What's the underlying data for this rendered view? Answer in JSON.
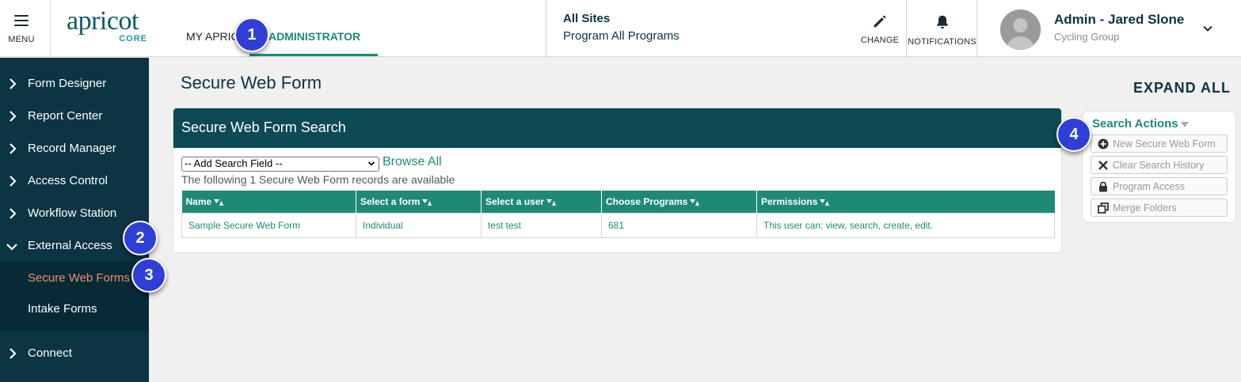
{
  "topbar": {
    "menu_label": "MENU",
    "logo_word": "apricot",
    "logo_sub": "CORE",
    "tabs": [
      {
        "label": "MY APRICOT"
      },
      {
        "label": "ADMINISTRATOR"
      }
    ],
    "site": {
      "name": "All Sites",
      "program": "Program All Programs"
    },
    "change_label": "CHANGE",
    "notifications_label": "NOTIFICATIONS",
    "user": {
      "name": "Admin - Jared Slone",
      "group": "Cycling Group"
    }
  },
  "sidebar": {
    "items": [
      {
        "label": "Form Designer"
      },
      {
        "label": "Report Center"
      },
      {
        "label": "Record Manager"
      },
      {
        "label": "Access Control"
      },
      {
        "label": "Workflow Station"
      },
      {
        "label": "External Access"
      },
      {
        "label": "Connect"
      }
    ],
    "sub_items": [
      {
        "label": "Secure Web Forms",
        "active": true
      },
      {
        "label": "Intake Forms"
      }
    ]
  },
  "main": {
    "page_title": "Secure Web Form",
    "expand_all": "EXPAND ALL",
    "panel_title": "Secure Web Form Search",
    "search_field_selected": "-- Add Search Field --",
    "browse_all": "Browse All",
    "records_note": "The following 1 Secure Web Form records are available",
    "table": {
      "columns": [
        "Name",
        "Select a form",
        "Select a user",
        "Choose Programs",
        "Permissions"
      ],
      "rows": [
        [
          "Sample Secure Web Form",
          "Individual",
          "test test",
          "681",
          "This user can: view, search, create, edit."
        ]
      ]
    }
  },
  "search_actions": {
    "title": "Search Actions",
    "buttons": [
      {
        "label": "New Secure Web Form",
        "icon": "plus-circle-icon"
      },
      {
        "label": "Clear Search History",
        "icon": "x-icon"
      },
      {
        "label": "Program Access",
        "icon": "lock-icon"
      },
      {
        "label": "Merge Folders",
        "icon": "merge-folders-icon"
      }
    ]
  },
  "callouts": [
    "1",
    "2",
    "3",
    "4"
  ],
  "colors": {
    "navy": "#0c3442",
    "teal": "#1e8a75",
    "active_sub": "#e8926a",
    "badge": "#2f3fd6"
  }
}
